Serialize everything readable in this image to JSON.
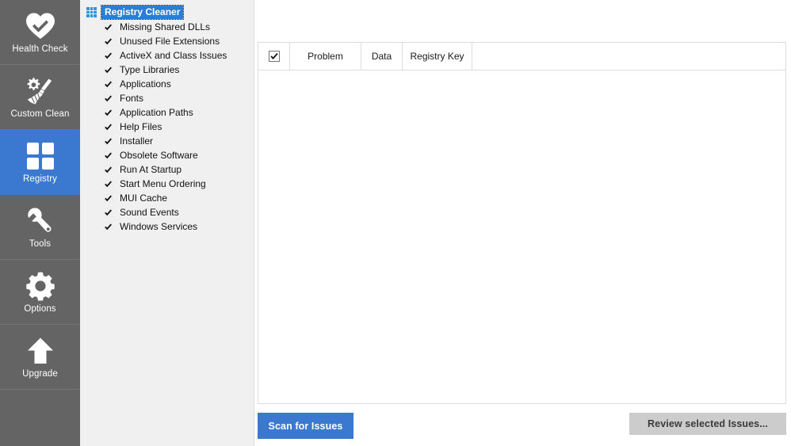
{
  "sidebar": {
    "items": [
      {
        "label": "Health Check",
        "icon": "heart-check-icon",
        "active": false
      },
      {
        "label": "Custom Clean",
        "icon": "broom-gear-icon",
        "active": false
      },
      {
        "label": "Registry",
        "icon": "grid-squares-icon",
        "active": true
      },
      {
        "label": "Tools",
        "icon": "wrench-icon",
        "active": false
      },
      {
        "label": "Options",
        "icon": "gear-icon",
        "active": false
      },
      {
        "label": "Upgrade",
        "icon": "up-arrow-icon",
        "active": false
      }
    ]
  },
  "tree": {
    "root": {
      "label": "Registry Cleaner",
      "icon": "grid-squares-icon",
      "selected": true
    },
    "items": [
      {
        "label": "Missing Shared DLLs",
        "checked": true
      },
      {
        "label": "Unused File Extensions",
        "checked": true
      },
      {
        "label": "ActiveX and Class Issues",
        "checked": true
      },
      {
        "label": "Type Libraries",
        "checked": true
      },
      {
        "label": "Applications",
        "checked": true
      },
      {
        "label": "Fonts",
        "checked": true
      },
      {
        "label": "Application Paths",
        "checked": true
      },
      {
        "label": "Help Files",
        "checked": true
      },
      {
        "label": "Installer",
        "checked": true
      },
      {
        "label": "Obsolete Software",
        "checked": true
      },
      {
        "label": "Run At Startup",
        "checked": true
      },
      {
        "label": "Start Menu Ordering",
        "checked": true
      },
      {
        "label": "MUI Cache",
        "checked": true
      },
      {
        "label": "Sound Events",
        "checked": true
      },
      {
        "label": "Windows Services",
        "checked": true
      }
    ]
  },
  "results": {
    "select_all_checked": true,
    "columns": [
      "Problem",
      "Data",
      "Registry Key"
    ],
    "rows": []
  },
  "actions": {
    "scan_label": "Scan for Issues",
    "review_label": "Review selected Issues..."
  },
  "colors": {
    "accent_blue": "#3b78d0",
    "selection_blue": "#2a7fd4",
    "sidebar_gray": "#646464",
    "panel_gray": "#f0f0f0",
    "disabled_button_gray": "#cccccc"
  }
}
